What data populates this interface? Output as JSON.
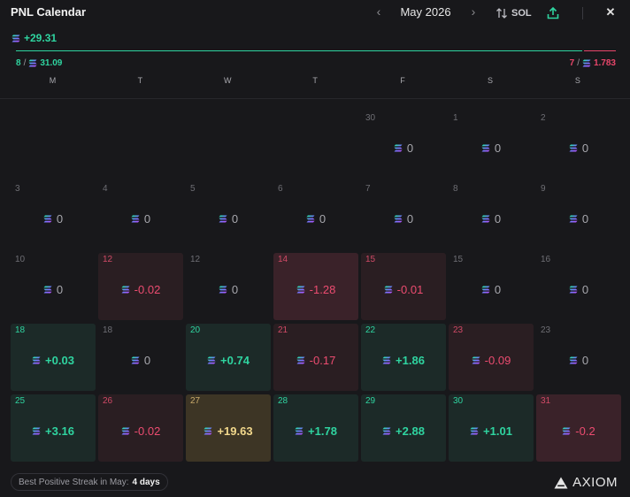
{
  "header": {
    "title": "PNL Calendar",
    "month": "May 2026",
    "currency": "SOL"
  },
  "summary": {
    "total_pnl": "+29.31",
    "win_days": "8",
    "win_amount": "31.09",
    "loss_days": "7",
    "loss_amount": "1.783",
    "win_fraction": 0.946
  },
  "weekdays": [
    "M",
    "T",
    "W",
    "T",
    "F",
    "S",
    "S"
  ],
  "days": [
    {
      "day": "30",
      "pnl": "0",
      "status": "zero"
    },
    {
      "day": "1",
      "pnl": "0",
      "status": "zero"
    },
    {
      "day": "2",
      "pnl": "0",
      "status": "zero"
    },
    {
      "day": "3",
      "pnl": "0",
      "status": "zero"
    },
    {
      "day": "4",
      "pnl": "0",
      "status": "zero"
    },
    {
      "day": "5",
      "pnl": "0",
      "status": "zero"
    },
    {
      "day": "6",
      "pnl": "0",
      "status": "zero"
    },
    {
      "day": "7",
      "pnl": "0",
      "status": "zero"
    },
    {
      "day": "8",
      "pnl": "0",
      "status": "zero"
    },
    {
      "day": "9",
      "pnl": "0",
      "status": "zero"
    },
    {
      "day": "10",
      "pnl": "0",
      "status": "zero"
    },
    {
      "day": "12",
      "pnl": "-0.02",
      "status": "neg"
    },
    {
      "day": "12",
      "pnl": "0",
      "status": "zero"
    },
    {
      "day": "14",
      "pnl": "-1.28",
      "status": "neg2"
    },
    {
      "day": "15",
      "pnl": "-0.01",
      "status": "neg"
    },
    {
      "day": "15",
      "pnl": "0",
      "status": "zero"
    },
    {
      "day": "16",
      "pnl": "0",
      "status": "zero"
    },
    {
      "day": "18",
      "pnl": "+0.03",
      "status": "pos"
    },
    {
      "day": "18",
      "pnl": "0",
      "status": "zero"
    },
    {
      "day": "20",
      "pnl": "+0.74",
      "status": "pos"
    },
    {
      "day": "21",
      "pnl": "-0.17",
      "status": "neg"
    },
    {
      "day": "22",
      "pnl": "+1.86",
      "status": "pos"
    },
    {
      "day": "23",
      "pnl": "-0.09",
      "status": "neg"
    },
    {
      "day": "23",
      "pnl": "0",
      "status": "zero"
    },
    {
      "day": "25",
      "pnl": "+3.16",
      "status": "pos"
    },
    {
      "day": "26",
      "pnl": "-0.02",
      "status": "neg"
    },
    {
      "day": "27",
      "pnl": "+19.63",
      "status": "gold"
    },
    {
      "day": "28",
      "pnl": "+1.78",
      "status": "pos"
    },
    {
      "day": "29",
      "pnl": "+2.88",
      "status": "pos"
    },
    {
      "day": "30",
      "pnl": "+1.01",
      "status": "pos"
    },
    {
      "day": "31",
      "pnl": "-0.2",
      "status": "neg2"
    }
  ],
  "footer": {
    "streak_label": "Best Positive Streak in May:",
    "streak_value": "4 days",
    "brand": "AXIOM"
  },
  "icons": {
    "token": "sol-icon",
    "sort": "sort-arrows-icon",
    "export": "upload-icon",
    "close": "close-icon",
    "brand": "axiom-logo-icon"
  },
  "colors": {
    "positive": "#2fd4a0",
    "negative": "#ec4c70",
    "highlight": "#f2d88c",
    "background": "#18181b"
  }
}
